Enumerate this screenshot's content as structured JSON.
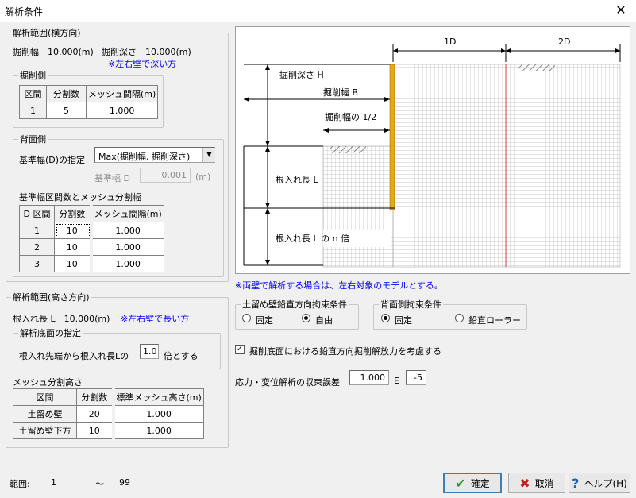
{
  "window": {
    "title": "解析条件"
  },
  "horizontal": {
    "legend": "解析範囲(横方向)",
    "width_text": "掘削幅　10.000(m)",
    "depth_text": "掘削深さ　10.000(m)",
    "note": "※左右壁で深い方",
    "excavation": {
      "legend": "掘削側",
      "headers": [
        "区間",
        "分割数",
        "メッシュ間隔(m)"
      ],
      "rows": [
        [
          "1",
          "5",
          "1.000"
        ]
      ]
    },
    "back": {
      "legend": "背面側",
      "ref_label": "基準幅(D)の指定",
      "ref_select": "Max(掘削幅, 掘削深さ)",
      "refD_label": "基準幅 D",
      "refD_value": "0.001",
      "refD_unit": "(m)",
      "section_label": "基準幅区間数とメッシュ分割幅",
      "headers": [
        "D 区間",
        "分割数",
        "メッシュ間隔(m)"
      ],
      "rows": [
        [
          "1",
          "10",
          "1.000"
        ],
        [
          "2",
          "10",
          "1.000"
        ],
        [
          "3",
          "10",
          "1.000"
        ]
      ]
    }
  },
  "vertical": {
    "legend": "解析範囲(高さ方向)",
    "embed_text": "根入れ長 L　10.000(m)",
    "note": "※左右壁で長い方",
    "bottom": {
      "legend": "解析底面の指定",
      "prefix": "根入れ先端から根入れ長Lの",
      "value": "1.0",
      "suffix": "倍とする"
    },
    "mesh_label": "メッシュ分割高さ",
    "headers": [
      "区間",
      "分割数",
      "標準メッシュ高さ(m)"
    ],
    "rows": [
      [
        "土留め壁",
        "20",
        "1.000"
      ],
      [
        "土留め壁下方",
        "10",
        "1.000"
      ]
    ]
  },
  "diagram": {
    "label_1d": "1D",
    "label_2d": "2D",
    "depth_H": "掘削深さ H",
    "width_B": "掘削幅 B",
    "half_width": "掘削幅の 1/2",
    "embed_L": "根入れ長 L",
    "embed_nL": "根入れ長 L の n 倍",
    "note": "※両壁で解析する場合は、左右対象のモデルとする。",
    "accent_wall": "#e6a817",
    "accent_line": "#d04040"
  },
  "wall_vertical": {
    "legend": "土留め壁鉛直方向拘束条件",
    "options": [
      "固定",
      "自由"
    ],
    "selected": "自由"
  },
  "back_restraint": {
    "legend": "背面側拘束条件",
    "options": [
      "固定",
      "鉛直ローラー"
    ],
    "selected": "固定"
  },
  "release_check": "掘削底面における鉛直方向掘削解放力を考慮する",
  "convergence": {
    "label": "応力・変位解析の収束誤差",
    "mantissa": "1.000",
    "e_label": "E",
    "exponent": "-5"
  },
  "status": {
    "range_label": "範囲:",
    "range_from": "1",
    "tilde": "〜",
    "range_to": "99"
  },
  "buttons": {
    "ok": "確定",
    "cancel": "取消",
    "help": "ヘルプ(H)"
  }
}
